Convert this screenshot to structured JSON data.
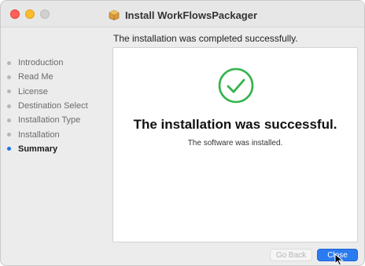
{
  "window": {
    "title": "Install WorkFlowsPackager"
  },
  "header": {
    "subtitle": "The installation was completed successfully."
  },
  "sidebar": {
    "items": [
      {
        "label": "Introduction",
        "active": false
      },
      {
        "label": "Read Me",
        "active": false
      },
      {
        "label": "License",
        "active": false
      },
      {
        "label": "Destination Select",
        "active": false
      },
      {
        "label": "Installation Type",
        "active": false
      },
      {
        "label": "Installation",
        "active": false
      },
      {
        "label": "Summary",
        "active": true
      }
    ]
  },
  "main": {
    "headline": "The installation was successful.",
    "message": "The software was installed.",
    "icon": "checkmark-circle-icon"
  },
  "footer": {
    "back_label": "Go Back",
    "close_label": "Close"
  },
  "colors": {
    "accent": "#1f74ea",
    "success": "#33b34a",
    "close_dot": "#ff5f57",
    "minimize_dot": "#febc2e"
  }
}
